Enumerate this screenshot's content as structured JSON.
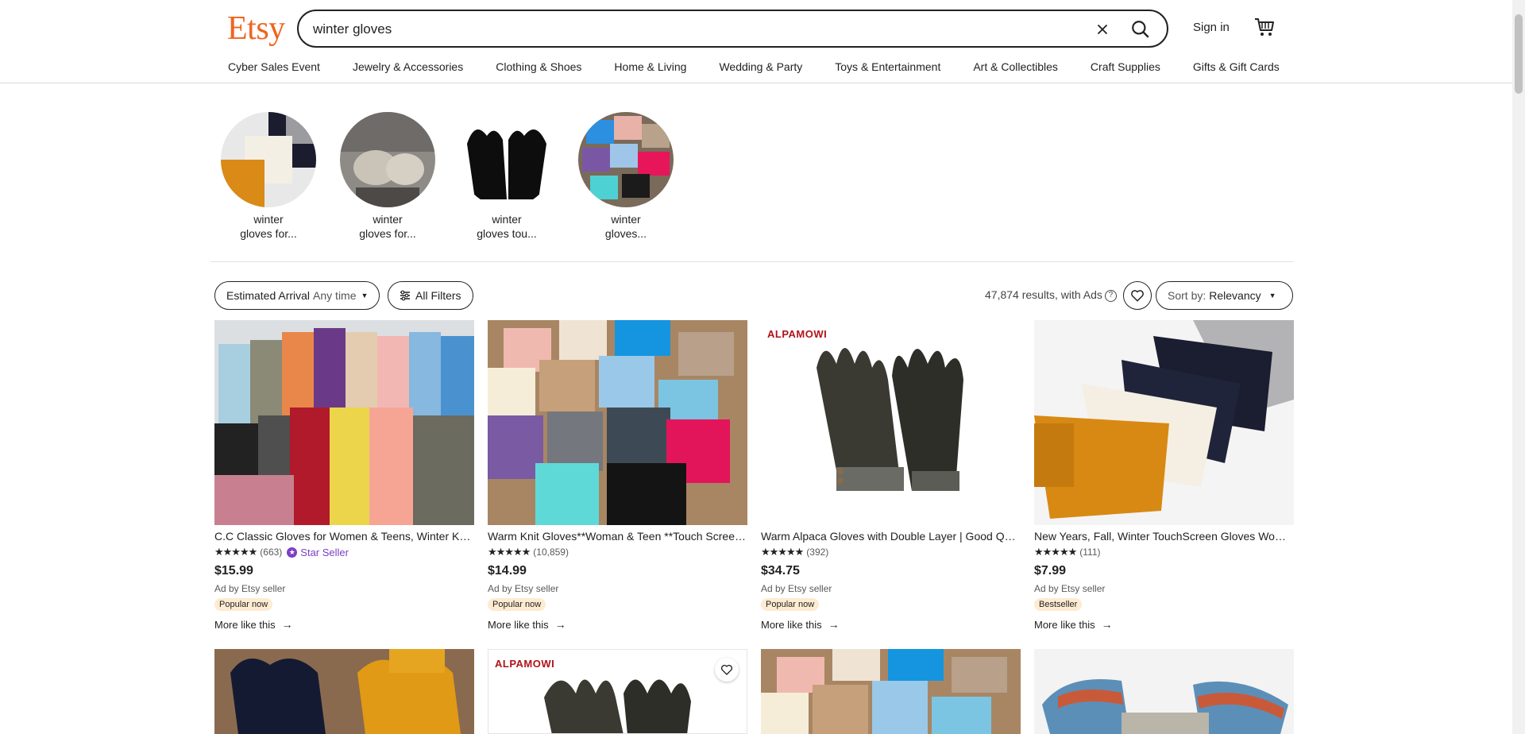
{
  "header": {
    "logo": "Etsy",
    "search_value": "winter gloves",
    "sign_in": "Sign in"
  },
  "nav": [
    "Cyber Sales Event",
    "Jewelry & Accessories",
    "Clothing & Shoes",
    "Home & Living",
    "Wedding & Party",
    "Toys & Entertainment",
    "Art & Collectibles",
    "Craft Supplies",
    "Gifts & Gift Cards"
  ],
  "related": [
    {
      "line1": "winter",
      "line2": "gloves for..."
    },
    {
      "line1": "winter",
      "line2": "gloves for..."
    },
    {
      "line1": "winter",
      "line2": "gloves tou..."
    },
    {
      "line1": "winter",
      "line2": "gloves..."
    }
  ],
  "filters": {
    "arrival_label": "Estimated Arrival",
    "arrival_value": "Any time",
    "all_filters": "All Filters",
    "results_text": "47,874 results, with Ads",
    "sort_label": "Sort by:",
    "sort_value": "Relevancy"
  },
  "listings": [
    {
      "title": "C.C Classic Gloves for Women & Teens, Winter Knit Gloves",
      "stars": "★★★★★",
      "reviews": "(663)",
      "star_seller": "Star Seller",
      "price": "$15.99",
      "ad": "Ad by Etsy seller",
      "tag": "Popular now",
      "more": "More like this"
    },
    {
      "title": "Warm Knit Gloves**Woman & Teen **Touch Screen Gloves",
      "stars": "★★★★★",
      "reviews": "(10,859)",
      "price": "$14.99",
      "ad": "Ad by Etsy seller",
      "tag": "Popular now",
      "more": "More like this"
    },
    {
      "title": "Warm Alpaca Gloves with Double Layer | Good Quality",
      "stars": "★★★★★",
      "reviews": "(392)",
      "price": "$34.75",
      "ad": "Ad by Etsy seller",
      "tag": "Popular now",
      "more": "More like this",
      "brand": "ALPAMOWI"
    },
    {
      "title": "New Years, Fall, Winter TouchScreen Gloves Women",
      "stars": "★★★★★",
      "reviews": "(111)",
      "price": "$7.99",
      "ad": "Ad by Etsy seller",
      "tag": "Bestseller",
      "more": "More like this"
    }
  ],
  "row2": [
    {
      "brand": ""
    },
    {
      "brand": "ALPAMOWI"
    },
    {
      "brand": ""
    },
    {
      "brand": ""
    }
  ],
  "colors": {
    "brand": "#f1641e",
    "star_seller": "#7b3fc4",
    "tag_bg": "#fdebd2"
  }
}
